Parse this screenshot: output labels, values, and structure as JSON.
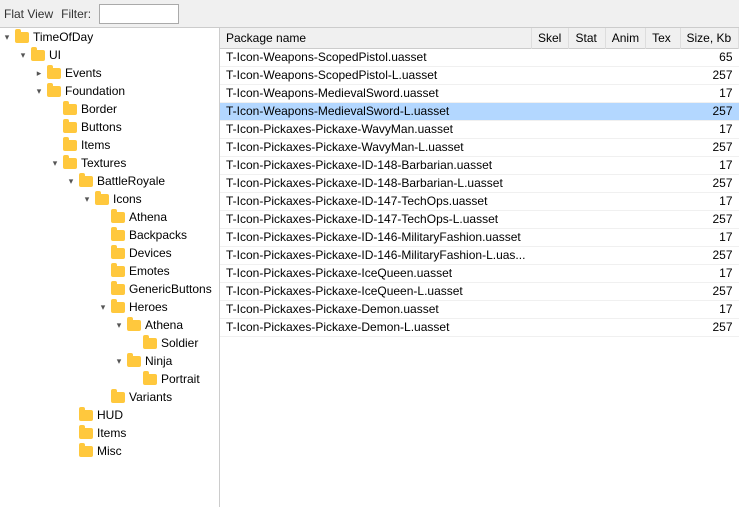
{
  "toolbar": {
    "flat_view_label": "Flat View",
    "filter_label": "Filter:",
    "filter_value": ""
  },
  "tree": {
    "nodes": [
      {
        "id": "timeofday",
        "label": "TimeOfDay",
        "depth": 0,
        "expanded": true,
        "type": "folder",
        "expandable": true
      },
      {
        "id": "ui",
        "label": "UI",
        "depth": 1,
        "expanded": true,
        "type": "folder",
        "expandable": true
      },
      {
        "id": "events",
        "label": "Events",
        "depth": 2,
        "expanded": false,
        "type": "folder",
        "expandable": true
      },
      {
        "id": "foundation",
        "label": "Foundation",
        "depth": 2,
        "expanded": true,
        "type": "folder",
        "expandable": true
      },
      {
        "id": "border",
        "label": "Border",
        "depth": 3,
        "expanded": false,
        "type": "folder",
        "expandable": false
      },
      {
        "id": "buttons",
        "label": "Buttons",
        "depth": 3,
        "expanded": false,
        "type": "folder",
        "expandable": false
      },
      {
        "id": "items",
        "label": "Items",
        "depth": 3,
        "expanded": false,
        "type": "folder",
        "expandable": false
      },
      {
        "id": "textures",
        "label": "Textures",
        "depth": 3,
        "expanded": true,
        "type": "folder",
        "expandable": true
      },
      {
        "id": "battleroyale",
        "label": "BattleRoyale",
        "depth": 4,
        "expanded": true,
        "type": "folder",
        "expandable": true
      },
      {
        "id": "icons",
        "label": "Icons",
        "depth": 5,
        "expanded": true,
        "type": "folder",
        "expandable": true
      },
      {
        "id": "athena-icons",
        "label": "Athena",
        "depth": 6,
        "expanded": false,
        "type": "folder",
        "expandable": false
      },
      {
        "id": "backpacks",
        "label": "Backpacks",
        "depth": 6,
        "expanded": false,
        "type": "folder",
        "expandable": false
      },
      {
        "id": "devices",
        "label": "Devices",
        "depth": 6,
        "expanded": false,
        "type": "folder",
        "expandable": false
      },
      {
        "id": "emotes",
        "label": "Emotes",
        "depth": 6,
        "expanded": false,
        "type": "folder",
        "expandable": false
      },
      {
        "id": "genericbuttons",
        "label": "GenericButtons",
        "depth": 6,
        "expanded": false,
        "type": "folder",
        "expandable": false
      },
      {
        "id": "heroes",
        "label": "Heroes",
        "depth": 6,
        "expanded": true,
        "type": "folder",
        "expandable": true
      },
      {
        "id": "athena-heroes",
        "label": "Athena",
        "depth": 7,
        "expanded": true,
        "type": "folder",
        "expandable": true
      },
      {
        "id": "soldier",
        "label": "Soldier",
        "depth": 8,
        "expanded": false,
        "type": "folder",
        "expandable": false
      },
      {
        "id": "ninja",
        "label": "Ninja",
        "depth": 7,
        "expanded": true,
        "type": "folder",
        "expandable": true
      },
      {
        "id": "portrait",
        "label": "Portrait",
        "depth": 8,
        "expanded": false,
        "type": "folder",
        "expandable": false
      },
      {
        "id": "variants",
        "label": "Variants",
        "depth": 6,
        "expanded": false,
        "type": "folder",
        "expandable": false
      },
      {
        "id": "hud",
        "label": "HUD",
        "depth": 4,
        "expanded": false,
        "type": "folder",
        "expandable": false
      },
      {
        "id": "items2",
        "label": "Items",
        "depth": 4,
        "expanded": false,
        "type": "folder",
        "expandable": false
      },
      {
        "id": "misc",
        "label": "Misc",
        "depth": 4,
        "expanded": false,
        "type": "folder",
        "expandable": false
      }
    ]
  },
  "files": {
    "columns": [
      {
        "id": "name",
        "label": "Package name"
      },
      {
        "id": "skel",
        "label": "Skel"
      },
      {
        "id": "stat",
        "label": "Stat"
      },
      {
        "id": "anim",
        "label": "Anim"
      },
      {
        "id": "tex",
        "label": "Tex"
      },
      {
        "id": "size",
        "label": "Size, Kb"
      }
    ],
    "rows": [
      {
        "name": "T-Icon-Weapons-ScopedPistol.uasset",
        "skel": "",
        "stat": "",
        "anim": "",
        "tex": "",
        "size": "65",
        "selected": false
      },
      {
        "name": "T-Icon-Weapons-ScopedPistol-L.uasset",
        "skel": "",
        "stat": "",
        "anim": "",
        "tex": "",
        "size": "257",
        "selected": false
      },
      {
        "name": "T-Icon-Weapons-MedievalSword.uasset",
        "skel": "",
        "stat": "",
        "anim": "",
        "tex": "",
        "size": "17",
        "selected": false
      },
      {
        "name": "T-Icon-Weapons-MedievalSword-L.uasset",
        "skel": "",
        "stat": "",
        "anim": "",
        "tex": "",
        "size": "257",
        "selected": true
      },
      {
        "name": "T-Icon-Pickaxes-Pickaxe-WavyMan.uasset",
        "skel": "",
        "stat": "",
        "anim": "",
        "tex": "",
        "size": "17",
        "selected": false
      },
      {
        "name": "T-Icon-Pickaxes-Pickaxe-WavyMan-L.uasset",
        "skel": "",
        "stat": "",
        "anim": "",
        "tex": "",
        "size": "257",
        "selected": false
      },
      {
        "name": "T-Icon-Pickaxes-Pickaxe-ID-148-Barbarian.uasset",
        "skel": "",
        "stat": "",
        "anim": "",
        "tex": "",
        "size": "17",
        "selected": false
      },
      {
        "name": "T-Icon-Pickaxes-Pickaxe-ID-148-Barbarian-L.uasset",
        "skel": "",
        "stat": "",
        "anim": "",
        "tex": "",
        "size": "257",
        "selected": false
      },
      {
        "name": "T-Icon-Pickaxes-Pickaxe-ID-147-TechOps.uasset",
        "skel": "",
        "stat": "",
        "anim": "",
        "tex": "",
        "size": "17",
        "selected": false
      },
      {
        "name": "T-Icon-Pickaxes-Pickaxe-ID-147-TechOps-L.uasset",
        "skel": "",
        "stat": "",
        "anim": "",
        "tex": "",
        "size": "257",
        "selected": false
      },
      {
        "name": "T-Icon-Pickaxes-Pickaxe-ID-146-MilitaryFashion.uasset",
        "skel": "",
        "stat": "",
        "anim": "",
        "tex": "",
        "size": "17",
        "selected": false
      },
      {
        "name": "T-Icon-Pickaxes-Pickaxe-ID-146-MilitaryFashion-L.uas...",
        "skel": "",
        "stat": "",
        "anim": "",
        "tex": "",
        "size": "257",
        "selected": false
      },
      {
        "name": "T-Icon-Pickaxes-Pickaxe-IceQueen.uasset",
        "skel": "",
        "stat": "",
        "anim": "",
        "tex": "",
        "size": "17",
        "selected": false
      },
      {
        "name": "T-Icon-Pickaxes-Pickaxe-IceQueen-L.uasset",
        "skel": "",
        "stat": "",
        "anim": "",
        "tex": "",
        "size": "257",
        "selected": false
      },
      {
        "name": "T-Icon-Pickaxes-Pickaxe-Demon.uasset",
        "skel": "",
        "stat": "",
        "anim": "",
        "tex": "",
        "size": "17",
        "selected": false
      },
      {
        "name": "T-Icon-Pickaxes-Pickaxe-Demon-L.uasset",
        "skel": "",
        "stat": "",
        "anim": "",
        "tex": "",
        "size": "257",
        "selected": false
      }
    ]
  }
}
